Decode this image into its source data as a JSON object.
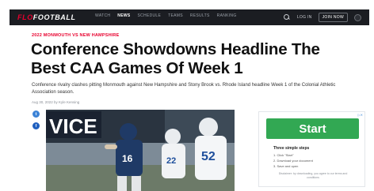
{
  "nav": {
    "logo_brand": "FLO",
    "logo_sport": "FOOTBALL",
    "links": [
      {
        "label": "WATCH",
        "active": false
      },
      {
        "label": "NEWS",
        "active": true
      },
      {
        "label": "SCHEDULE",
        "active": false
      },
      {
        "label": "TEAMS",
        "active": false
      },
      {
        "label": "RESULTS",
        "active": false
      },
      {
        "label": "RANKING",
        "active": false
      }
    ],
    "login_label": "LOG IN",
    "join_label": "JOIN NOW"
  },
  "article": {
    "tagline": "2022 MONMOUTH VS NEW HAMPSHIRE",
    "headline": "Conference Showdowns Headline The Best CAA Games Of Week 1",
    "summary": "Conference rivalry clashes pitting Monmouth against New Hampshire and Stony Brook vs. Rhode Island headline Week 1 of the Colonial Athletic Association season.",
    "byline": "Aug 30, 2022 by Kyle Kensing"
  },
  "share": {
    "twitter_glyph": "t",
    "facebook_glyph": "f"
  },
  "hero": {
    "banner_text": "VICE",
    "jersey_left": "16",
    "jersey_mid": "22",
    "jersey_right": "52"
  },
  "ad": {
    "badge": "▷✕",
    "button_label": "Start",
    "title": "Three simple steps",
    "steps": [
      "1. Click \"Start\"",
      "2. Download your document",
      "3. Save and open"
    ],
    "footer": "Disclaimer: by downloading, you agree to our terms and conditions"
  },
  "colors": {
    "brand_red": "#e8002e",
    "nav_bg": "#1b1d22",
    "ad_green": "#32a853",
    "twitter_blue": "#3b82d6",
    "facebook_blue": "#1f5fbf"
  }
}
